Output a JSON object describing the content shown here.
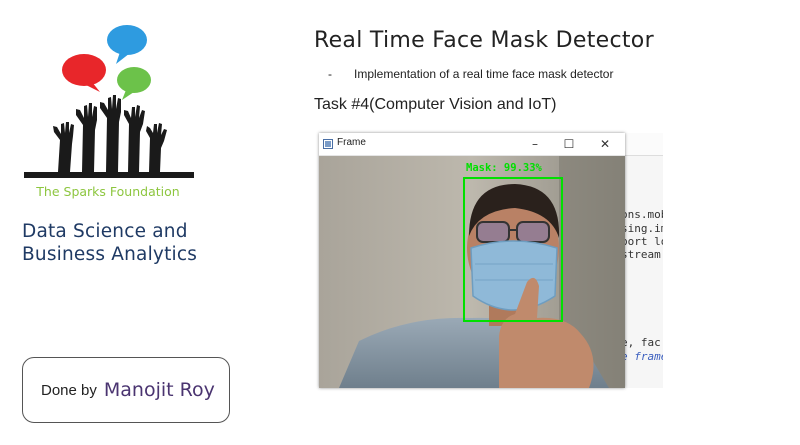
{
  "sidebar": {
    "org_name": "The Sparks Foundation",
    "subject_line1": "Data Science and",
    "subject_line2": "Business Analytics",
    "author_prefix": "Done by",
    "author_name": "Manojit Roy"
  },
  "slide": {
    "title": "Real Time Face Mask Detector",
    "bullet_marker": "-",
    "bullet_text": "Implementation of a real time face mask detector",
    "task": "Task #4(Computer Vision and IoT)"
  },
  "frame_window": {
    "title": "Frame",
    "detection_label": "Mask: 99.33%",
    "minimize_glyph": "–",
    "maximize_glyph": "☐",
    "close_glyph": "✕"
  },
  "editor": {
    "lines": [
      "ons.mob",
      "sing.im",
      "port lo",
      "stream",
      "e, fac",
      "e frame"
    ]
  },
  "colors": {
    "brand_green": "#8dc63f",
    "subject_blue": "#1f3a64",
    "author_purple": "#4a3470",
    "detection_green": "#00e000"
  },
  "icons": [
    "speech-bubble-red-icon",
    "speech-bubble-blue-icon",
    "speech-bubble-green-icon",
    "raised-hands-icon",
    "app-window-icon"
  ]
}
